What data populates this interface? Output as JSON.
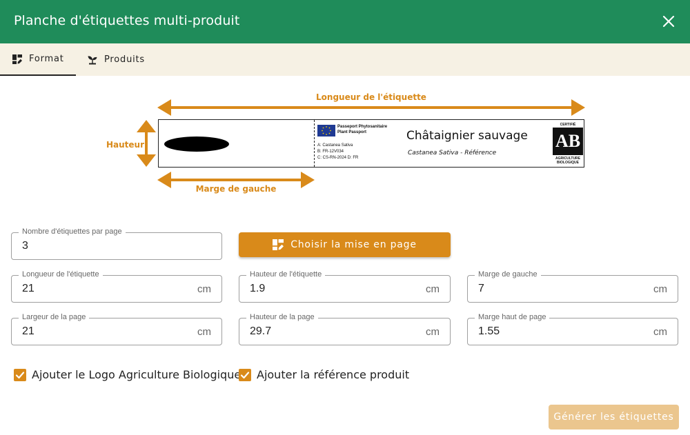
{
  "dialog": {
    "title": "Planche d'étiquettes multi-produit"
  },
  "tabs": [
    {
      "label": "Format"
    },
    {
      "label": "Produits"
    }
  ],
  "diagram": {
    "length_label": "Longueur de l'étiquette",
    "height_label": "Hauteur",
    "margin_label": "Marge de gauche",
    "passport_title_1": "Passeport Phytosanitaire",
    "passport_title_2": "Plant Passport",
    "passport_a": "A: Castanea Sativa",
    "passport_b": "B: FR-12V034",
    "passport_c": "C: CS-RN-2024  D: FR",
    "product_name": "Châtaignier sauvage",
    "product_ref": "Castanea Sativa - Référence",
    "ab_top": "CERTIFIÉ",
    "ab_letters": "AB",
    "ab_bottom_1": "AGRICULTURE",
    "ab_bottom_2": "BIOLOGIQUE"
  },
  "form": {
    "labels_per_page": {
      "label": "Nombre d'étiquettes par page",
      "value": "3"
    },
    "layout_button": "Choisir la mise en page",
    "label_length": {
      "label": "Longueur de l'étiquette",
      "value": "21",
      "unit": "cm"
    },
    "label_height": {
      "label": "Hauteur de l'étiquette",
      "value": "1.9",
      "unit": "cm"
    },
    "left_margin": {
      "label": "Marge de gauche",
      "value": "7",
      "unit": "cm"
    },
    "page_width": {
      "label": "Largeur de la page",
      "value": "21",
      "unit": "cm"
    },
    "page_height": {
      "label": "Hauteur de la page",
      "value": "29.7",
      "unit": "cm"
    },
    "top_margin": {
      "label": "Marge haut de page",
      "value": "1.55",
      "unit": "cm"
    },
    "check_bio": "Ajouter le Logo Agriculture Biologique",
    "check_ref": "Ajouter la référence produit",
    "generate_button": "Générer les étiquettes"
  },
  "colors": {
    "header": "#1f8c5a",
    "accent": "#d98a1a",
    "tabs_bg": "#f6f1e4"
  },
  "icons": {
    "close": "close-icon",
    "format": "layout-edit-icon",
    "products": "sprout-icon",
    "checkbox": "check-icon"
  }
}
